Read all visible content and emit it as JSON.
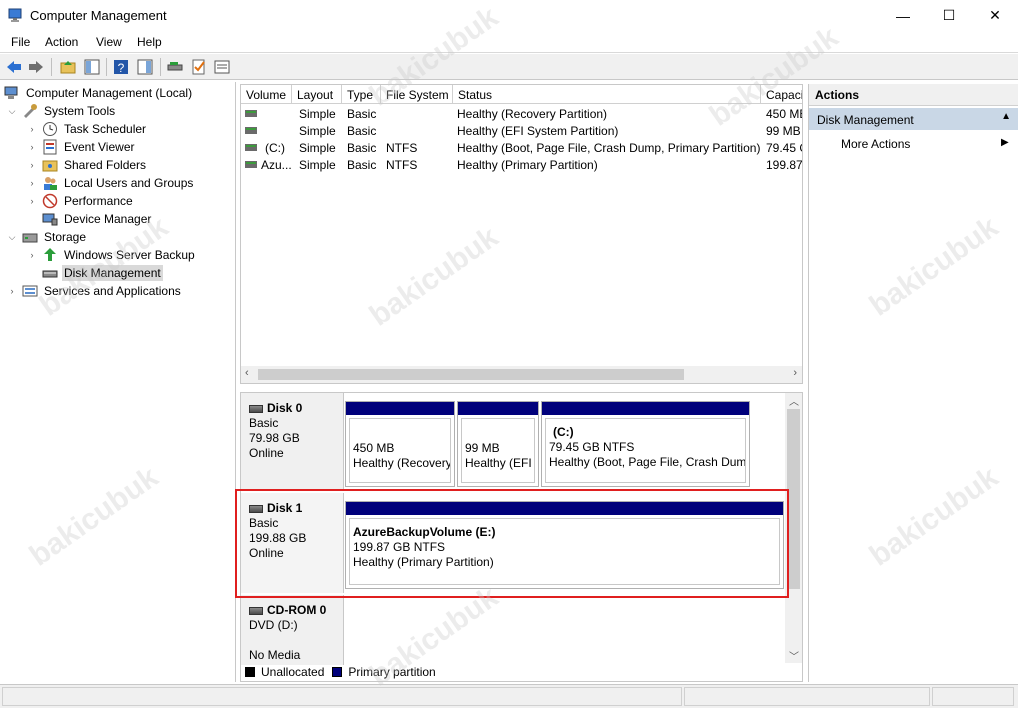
{
  "window": {
    "title": "Computer Management",
    "minimize_glyph": "—",
    "maximize_glyph": "☐",
    "close_glyph": "✕"
  },
  "menu": [
    "File",
    "Action",
    "View",
    "Help"
  ],
  "tree": {
    "root": "Computer Management (Local)",
    "items": [
      {
        "label": "System Tools",
        "icon": "tools-icon",
        "expander": "expanded"
      },
      {
        "label": "Task Scheduler",
        "icon": "clock-icon",
        "expander": "collapsed"
      },
      {
        "label": "Event Viewer",
        "icon": "event-viewer-icon",
        "expander": "collapsed"
      },
      {
        "label": "Shared Folders",
        "icon": "shared-folder-icon",
        "expander": "collapsed"
      },
      {
        "label": "Local Users and Groups",
        "icon": "users-icon",
        "expander": "collapsed"
      },
      {
        "label": "Performance",
        "icon": "performance-icon",
        "expander": "collapsed"
      },
      {
        "label": "Device Manager",
        "icon": "device-manager-icon",
        "expander": "none"
      },
      {
        "label": "Storage",
        "icon": "storage-icon",
        "expander": "expanded"
      },
      {
        "label": "Windows Server Backup",
        "icon": "backup-icon",
        "expander": "collapsed"
      },
      {
        "label": "Disk Management",
        "icon": "disk-icon",
        "expander": "none",
        "selected": true
      },
      {
        "label": "Services and Applications",
        "icon": "services-icon",
        "expander": "collapsed"
      }
    ]
  },
  "volumes": {
    "columns": [
      "Volume",
      "Layout",
      "Type",
      "File System",
      "Status",
      "Capaci"
    ],
    "rows": [
      {
        "volume": "",
        "layout": "Simple",
        "type": "Basic",
        "fs": "",
        "status": "Healthy (Recovery Partition)",
        "capacity": "450 MB"
      },
      {
        "volume": "",
        "layout": "Simple",
        "type": "Basic",
        "fs": "",
        "status": "Healthy (EFI System Partition)",
        "capacity": "99 MB"
      },
      {
        "volume": "(C:)",
        "layout": "Simple",
        "type": "Basic",
        "fs": "NTFS",
        "status": "Healthy (Boot, Page File, Crash Dump, Primary Partition)",
        "capacity": "79.45 G"
      },
      {
        "volume": "Azu...",
        "layout": "Simple",
        "type": "Basic",
        "fs": "NTFS",
        "status": "Healthy (Primary Partition)",
        "capacity": "199.87"
      }
    ]
  },
  "disks": {
    "disk0": {
      "name": "Disk 0",
      "type": "Basic",
      "size": "79.98 GB",
      "state": "Online",
      "partitions": [
        {
          "title": "",
          "size": "450 MB",
          "status": "Healthy (Recovery"
        },
        {
          "title": "",
          "size": "99 MB",
          "status": "Healthy (EFI S"
        },
        {
          "title": "(C:)",
          "size": "79.45 GB NTFS",
          "status": "Healthy (Boot, Page File, Crash Dump"
        }
      ]
    },
    "disk1": {
      "name": "Disk 1",
      "type": "Basic",
      "size": "199.88 GB",
      "state": "Online",
      "partitions": [
        {
          "title": "AzureBackupVolume  (E:)",
          "size": "199.87 GB NTFS",
          "status": "Healthy (Primary Partition)"
        }
      ]
    },
    "cdrom0": {
      "name": "CD-ROM 0",
      "type": "DVD (D:)",
      "state": "No Media"
    }
  },
  "legend": {
    "unallocated": "Unallocated",
    "primary": "Primary partition",
    "unallocated_color": "#000000",
    "primary_color": "#00007b"
  },
  "actions": {
    "header": "Actions",
    "section": "Disk Management",
    "more": "More Actions",
    "section_color": "#c9d7e6"
  },
  "watermark": "bakicubuk"
}
